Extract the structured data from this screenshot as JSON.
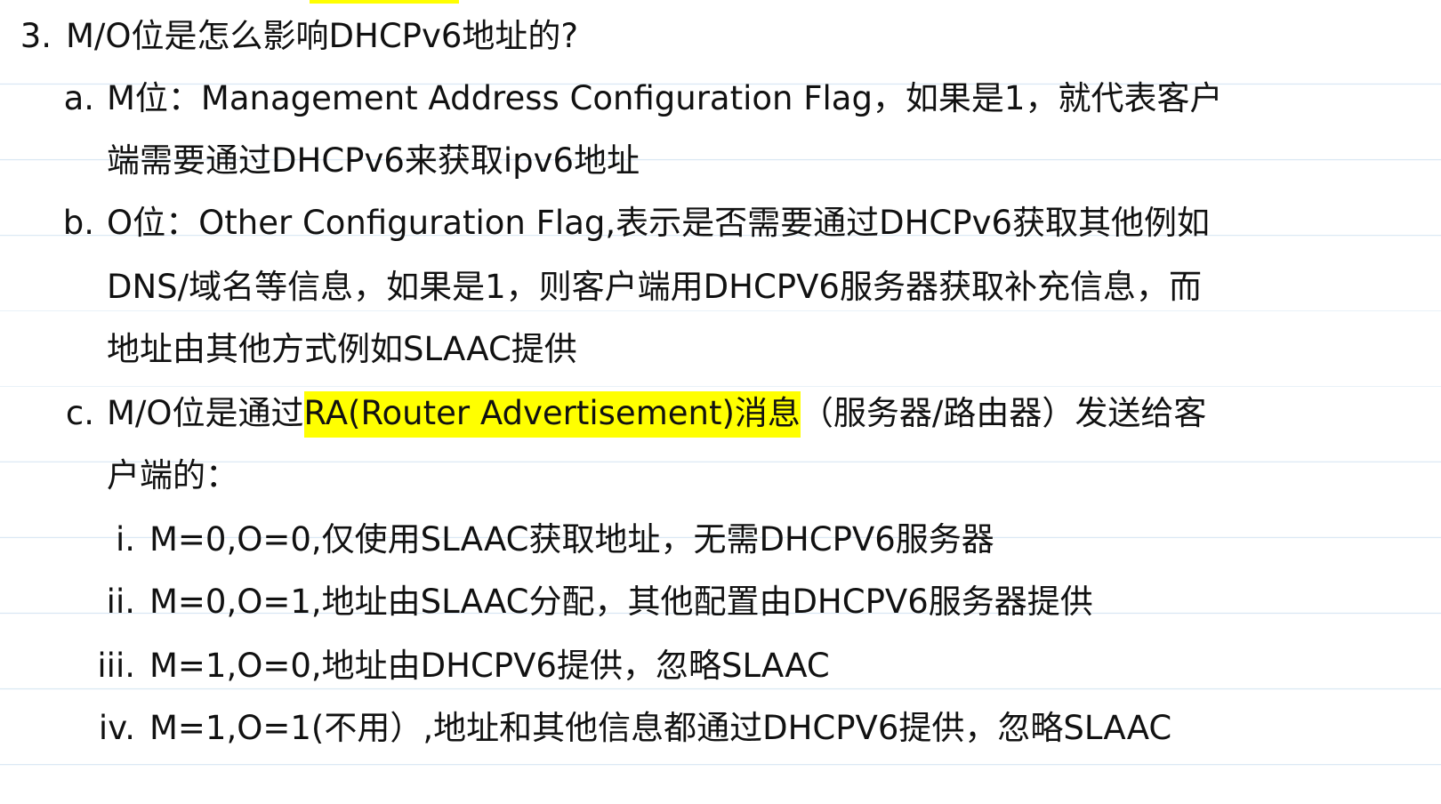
{
  "heading": {
    "number": "3.",
    "text": "M/O位是怎么影响DHCPv6地址的?"
  },
  "item_a": {
    "marker": "a.",
    "line1": "M位：Management Address Configuration Flag，如果是1，就代表客户",
    "line2": "端需要通过DHCPv6来获取ipv6地址"
  },
  "item_b": {
    "marker": "b.",
    "line1": "O位：Other Configuration Flag,表示是否需要通过DHCPv6获取其他例如",
    "line2": "DNS/域名等信息，如果是1，则客户端用DHCPV6服务器获取补充信息，而",
    "line3": "地址由其他方式例如SLAAC提供"
  },
  "item_c": {
    "marker": "c.",
    "line1_pre": "M/O位是通过",
    "line1_highlight": "RA(Router Advertisement)消息",
    "line1_post": "（服务器/路由器）发送给客",
    "line2": "户端的：",
    "subitems": [
      {
        "marker": "i.",
        "text": "M=0,O=0,仅使用SLAAC获取地址，无需DHCPV6服务器"
      },
      {
        "marker": "ii.",
        "text": "M=0,O=1,地址由SLAAC分配，其他配置由DHCPV6服务器提供"
      },
      {
        "marker": "iii.",
        "text": "M=1,O=0,地址由DHCPV6提供，忽略SLAAC"
      },
      {
        "marker": "iv.",
        "text": "M=1,O=1(不用）,地址和其他信息都通过DHCPV6提供，忽略SLAAC"
      }
    ]
  },
  "colors": {
    "highlight": "#ffff00",
    "text": "#111111",
    "ruled_line": "#d9e7f3"
  }
}
